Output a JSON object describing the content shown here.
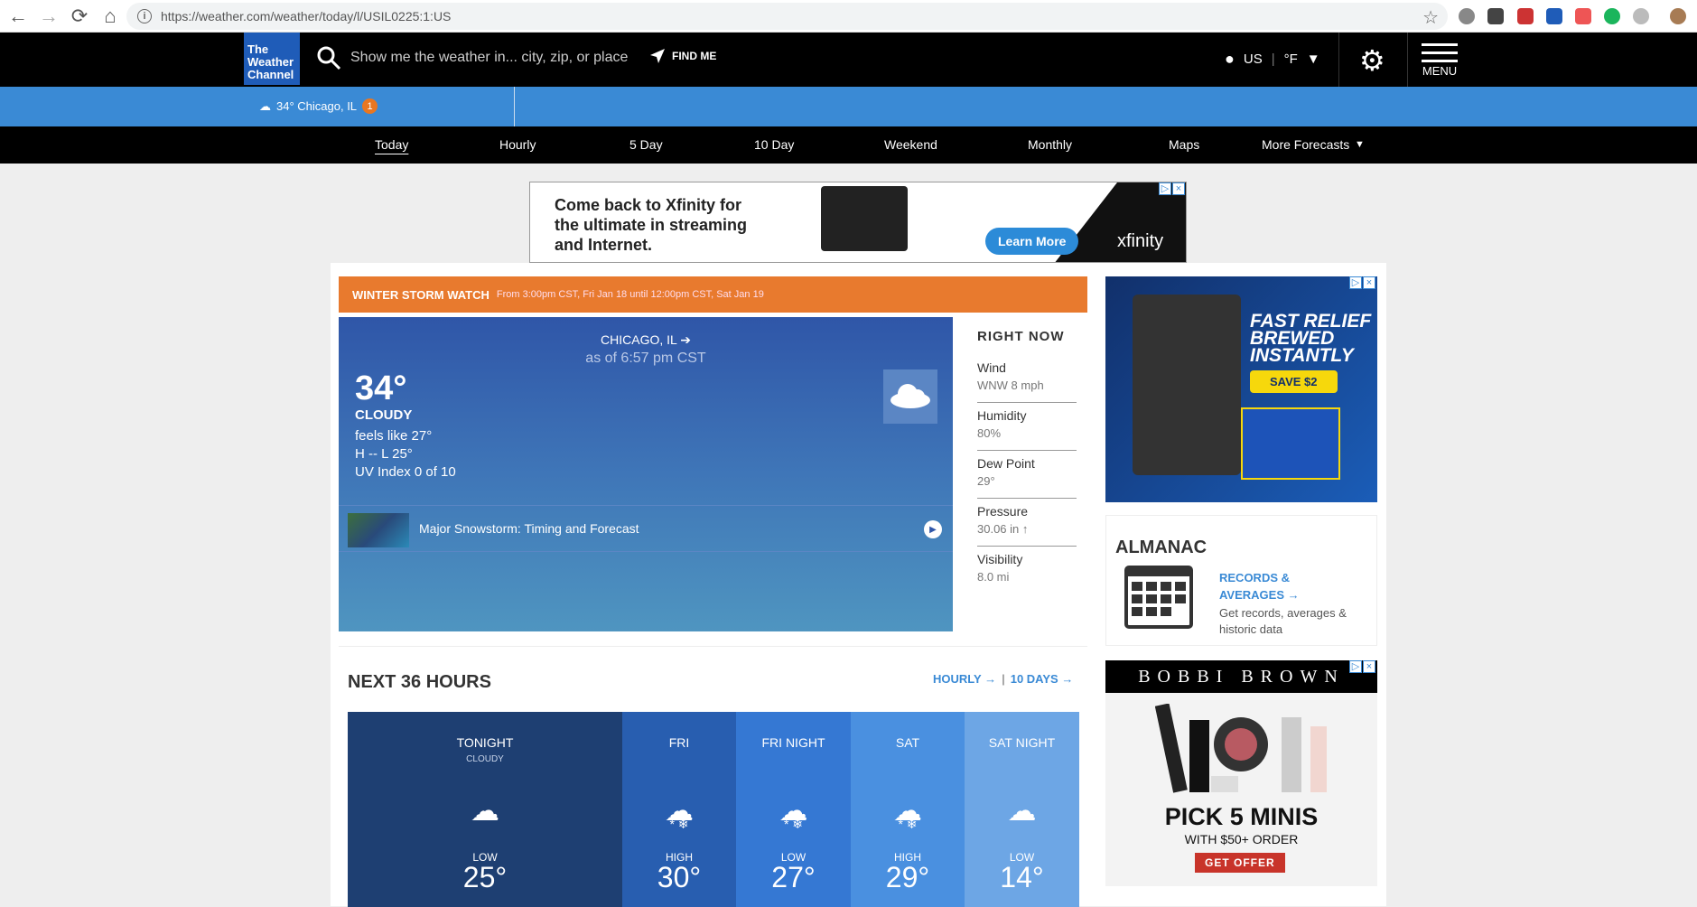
{
  "browser": {
    "url": "https://weather.com/weather/today/l/USIL0225:1:US"
  },
  "header": {
    "logo_line1": "The",
    "logo_line2": "Weather",
    "logo_line3": "Channel",
    "search_placeholder": "Show me the weather in... city, zip, or place",
    "find_me": "FIND ME",
    "country": "US",
    "unit": "°F",
    "menu_label": "MENU"
  },
  "current_location": {
    "text": "34° Chicago, IL",
    "badge": "1"
  },
  "tabs": [
    "Today",
    "Hourly",
    "5 Day",
    "10 Day",
    "Weekend",
    "Monthly",
    "Maps",
    "More Forecasts"
  ],
  "top_ad": {
    "text": "Come back to Xfinity for the ultimate in streaming and Internet.",
    "button": "Learn More",
    "brand": "xfinity"
  },
  "alert": {
    "title": "WINTER STORM WATCH",
    "detail": "From 3:00pm CST, Fri Jan 18 until 12:00pm CST, Sat Jan 19"
  },
  "current": {
    "location": "CHICAGO, IL",
    "as_of": "as of 6:57 pm CST",
    "temp": "34°",
    "phrase": "CLOUDY",
    "feels_like": "feels like 27°",
    "hilo": "H -- L 25°",
    "uv": "UV Index 0 of 10",
    "video_title": "Major Snowstorm: Timing and Forecast"
  },
  "right_now": {
    "title": "RIGHT NOW",
    "items": [
      {
        "label": "Wind",
        "value": "WNW 8 mph"
      },
      {
        "label": "Humidity",
        "value": "80%"
      },
      {
        "label": "Dew Point",
        "value": "29°"
      },
      {
        "label": "Pressure",
        "value": "30.06 in ↑"
      },
      {
        "label": "Visibility",
        "value": "8.0 mi"
      }
    ]
  },
  "side_ad1": {
    "headline": "FAST RELIEF BREWED INSTANTLY",
    "button": "SAVE $2"
  },
  "almanac": {
    "title": "ALMANAC",
    "link": "RECORDS & AVERAGES →",
    "desc": "Get records, averages & historic data"
  },
  "side_ad2": {
    "brand": "BOBBI BROWN",
    "headline": "PICK 5 MINIS",
    "sub": "WITH $50+ ORDER",
    "button": "GET OFFER"
  },
  "next36": {
    "title": "NEXT 36 HOURS",
    "hourly_link": "HOURLY →",
    "days_link": "10 DAYS →",
    "periods": [
      {
        "name": "TONIGHT",
        "cond": "CLOUDY",
        "label": "LOW",
        "temp": "25°",
        "color": "#1e3f72"
      },
      {
        "name": "FRI",
        "cond": "",
        "label": "HIGH",
        "temp": "30°",
        "color": "#285eb0"
      },
      {
        "name": "FRI NIGHT",
        "cond": "",
        "label": "LOW",
        "temp": "27°",
        "color": "#3578d3"
      },
      {
        "name": "SAT",
        "cond": "",
        "label": "HIGH",
        "temp": "29°",
        "color": "#4a90e0"
      },
      {
        "name": "SAT NIGHT",
        "cond": "",
        "label": "LOW",
        "temp": "14°",
        "color": "#6da6e5"
      }
    ]
  }
}
